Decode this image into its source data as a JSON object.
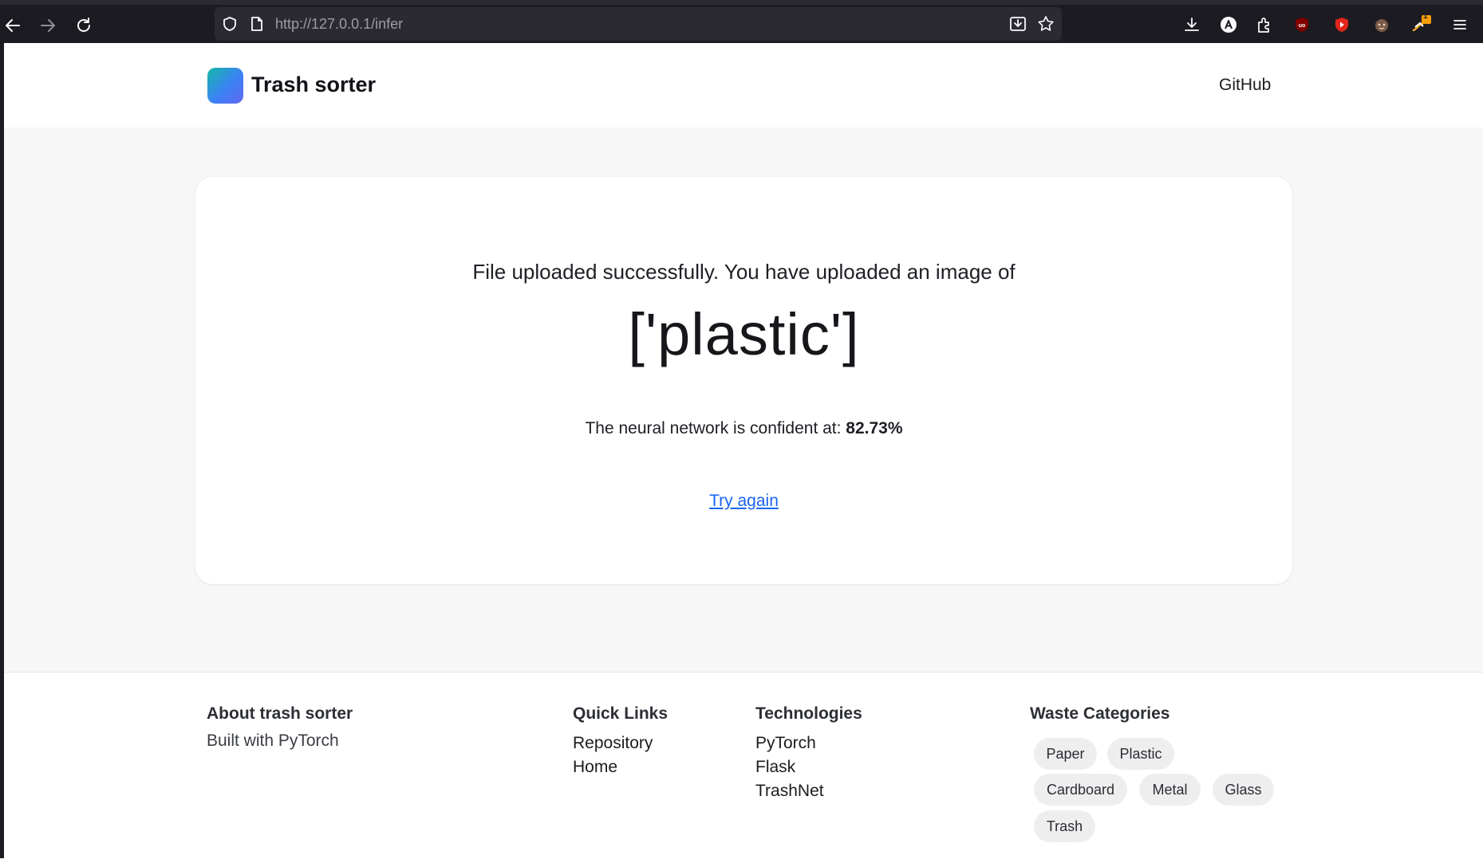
{
  "browser": {
    "url_host": "http://127.0.0.1",
    "url_path": "/infer",
    "icons": [
      "back-arrow-icon",
      "forward-arrow-icon",
      "reload-icon",
      "shield-icon",
      "page-icon",
      "save-to-pocket-icon",
      "bookmark-star-icon",
      "downloads-icon",
      "account-icon",
      "extensions-icon",
      "ublock-icon",
      "youtube-icon",
      "extension-face-icon",
      "notification-extension-icon",
      "menu-icon"
    ],
    "notification_badge": "1"
  },
  "header": {
    "brand": "Trash sorter",
    "nav_github": "GitHub"
  },
  "result": {
    "message": "File uploaded successfully. You have uploaded an image of",
    "prediction": "['plastic']",
    "confidence_prefix": "The neural network is confident at: ",
    "confidence_value": "82.73%",
    "try_again": "Try again"
  },
  "footer": {
    "about": {
      "title": "About trash sorter",
      "text": "Built with PyTorch"
    },
    "quick_links": {
      "title": "Quick Links",
      "items": [
        "Repository",
        "Home"
      ]
    },
    "technologies": {
      "title": "Technologies",
      "items": [
        "PyTorch",
        "Flask",
        "TrashNet"
      ]
    },
    "categories": {
      "title": "Waste Categories",
      "items": [
        "Paper",
        "Plastic",
        "Cardboard",
        "Metal",
        "Glass",
        "Trash"
      ]
    }
  },
  "colors": {
    "accent_link": "#1a63f0",
    "logo_gradient_start": "#14b8a6",
    "logo_gradient_end": "#6366f1",
    "page_bg": "#f7f7f8",
    "browser_chrome": "#1c1b22"
  }
}
